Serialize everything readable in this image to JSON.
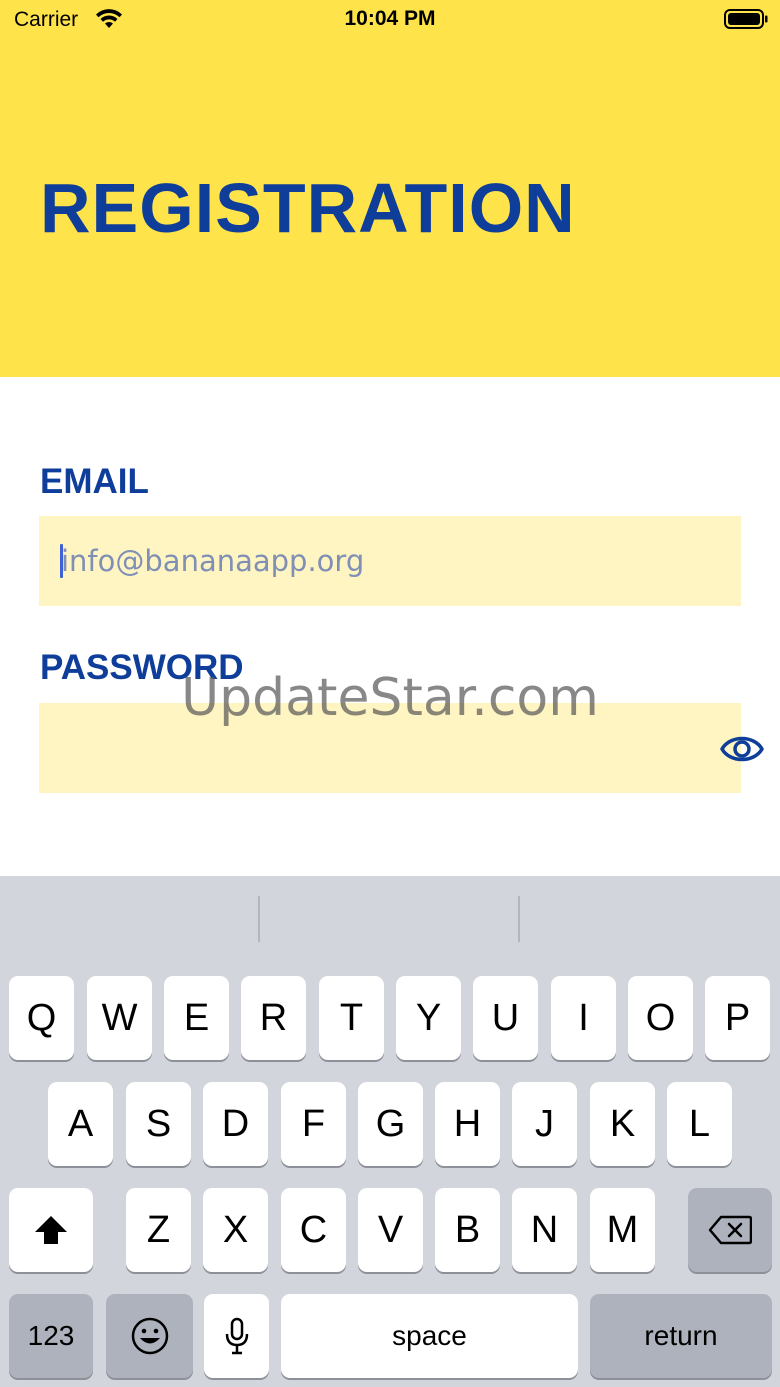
{
  "status_bar": {
    "carrier": "Carrier",
    "time": "10:04 PM"
  },
  "header": {
    "title": "REGISTRATION"
  },
  "form": {
    "email_label": "EMAIL",
    "email_placeholder": "info@bananaapp.org",
    "email_value": "",
    "password_label": "PASSWORD",
    "password_value": ""
  },
  "watermark": "UpdateStar.com",
  "icons": {
    "wifi": "wifi-icon",
    "battery": "battery-icon",
    "eye": "eye-icon",
    "shift": "shift-icon",
    "delete": "backspace-icon",
    "emoji": "emoji-icon",
    "mic": "microphone-icon"
  },
  "colors": {
    "header_bg": "#FFE34A",
    "accent_blue": "#0E3E9A",
    "field_bg": "#FFF5C2",
    "keyboard_bg": "#D3D5DC"
  },
  "keyboard": {
    "row1": [
      "Q",
      "W",
      "E",
      "R",
      "T",
      "Y",
      "U",
      "I",
      "O",
      "P"
    ],
    "row2": [
      "A",
      "S",
      "D",
      "F",
      "G",
      "H",
      "J",
      "K",
      "L"
    ],
    "row3": [
      "Z",
      "X",
      "C",
      "V",
      "B",
      "N",
      "M"
    ],
    "numbers_key": "123",
    "space_key": "space",
    "return_key": "return"
  }
}
